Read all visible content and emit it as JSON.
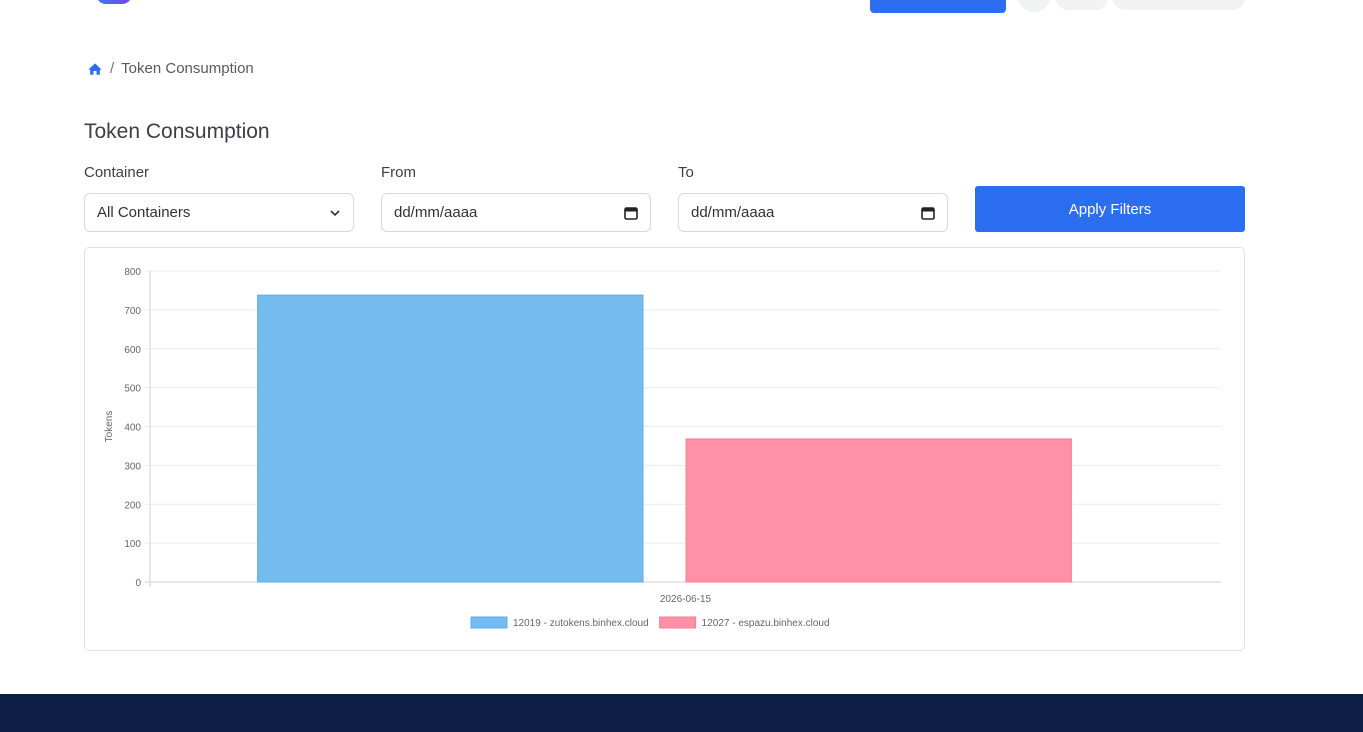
{
  "breadcrumb": {
    "current": "Token Consumption"
  },
  "page": {
    "title": "Token Consumption"
  },
  "filters": {
    "container": {
      "label": "Container",
      "value": "All Containers"
    },
    "from": {
      "label": "From",
      "value": "dd/mm/aaaa"
    },
    "to": {
      "label": "To",
      "value": "dd/mm/aaaa"
    },
    "apply_label": "Apply Filters"
  },
  "colors": {
    "accent": "#2b6ef2",
    "footer": "#0d1f45"
  },
  "chart_data": {
    "type": "bar",
    "categories": [
      "2026-06-15"
    ],
    "series": [
      {
        "name": "12019 - zutokens.binhex.cloud",
        "values": [
          738
        ],
        "color": "#74bcf0",
        "border": "#5aaee8"
      },
      {
        "name": "12027 - espazu.binhex.cloud",
        "values": [
          368
        ],
        "color": "#ff91a6",
        "border": "#ff7a94"
      }
    ],
    "ylabel": "Tokens",
    "xlabel": "",
    "ylim": [
      0,
      800
    ],
    "yticks": [
      0,
      100,
      200,
      300,
      400,
      500,
      600,
      700,
      800
    ],
    "grid": true,
    "legend": "bottom"
  }
}
